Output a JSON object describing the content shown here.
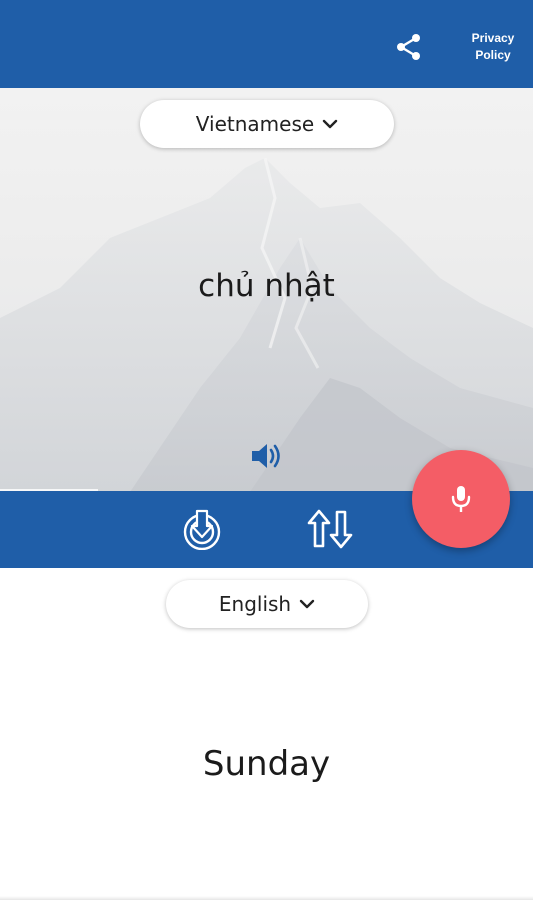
{
  "colors": {
    "primary": "#1f5ea8",
    "mic_button": "#f45d66",
    "background": "#ffffff"
  },
  "header": {
    "share_icon": "share-icon",
    "privacy_label": "Privacy\nPolicy"
  },
  "source": {
    "language": "Vietnamese",
    "text": "chủ nhật",
    "speaker_icon": "speaker-icon"
  },
  "toolbar": {
    "download_icon": "download-icon",
    "swap_icon": "swap-icon",
    "mic_icon": "mic-icon"
  },
  "target": {
    "language": "English",
    "text": "Sunday"
  }
}
